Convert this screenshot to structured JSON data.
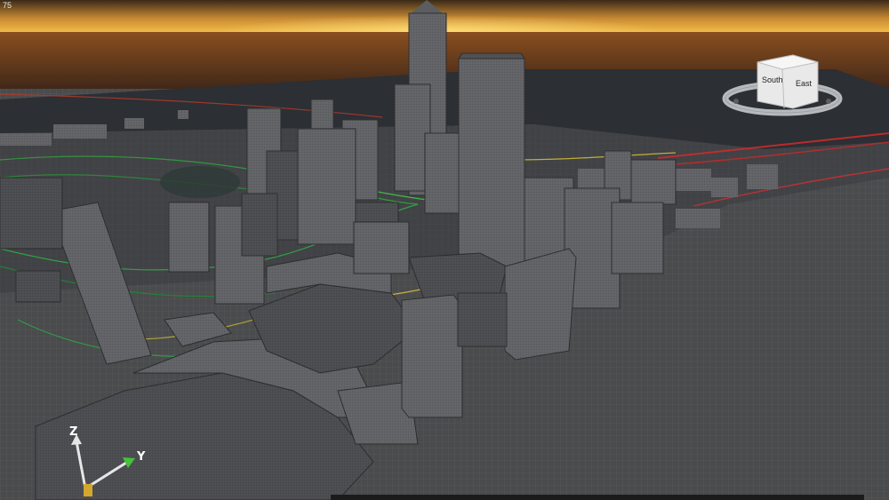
{
  "overlay": {
    "fps": "75"
  },
  "axis_gizmo": {
    "z_label": "Z",
    "y_label": "Y"
  },
  "view_cube": {
    "south_label": "South",
    "east_label": "East"
  },
  "colors": {
    "sky_top": "#5a3b1c",
    "sky_glow": "#f2b340",
    "ground": "#474849",
    "plate": "#2d3035",
    "building": "#5b5c5f",
    "building_edge": "#2e2f31",
    "stream_green": "#39c24a",
    "stream_red": "#d22b2b",
    "stream_yellow": "#d8c23a"
  }
}
